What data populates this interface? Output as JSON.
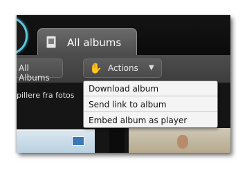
{
  "header": {
    "tab_label": "All albums"
  },
  "toolbar": {
    "all_albums_label": "All Albums",
    "actions_label": "Actions"
  },
  "content": {
    "description_text": "pillere fra fotos"
  },
  "menu": {
    "items": [
      {
        "label": "Download album"
      },
      {
        "label": "Send link to album"
      },
      {
        "label": "Embed album as player"
      }
    ]
  },
  "colors": {
    "accent": "#5ec7d8",
    "toolbar_bg": "#444444",
    "menu_bg": "#f4f4f4"
  },
  "icons": {
    "tab_icon": "album-icon",
    "actions_icon": "hand-icon",
    "dropdown_icon": "chevron-down-icon"
  }
}
